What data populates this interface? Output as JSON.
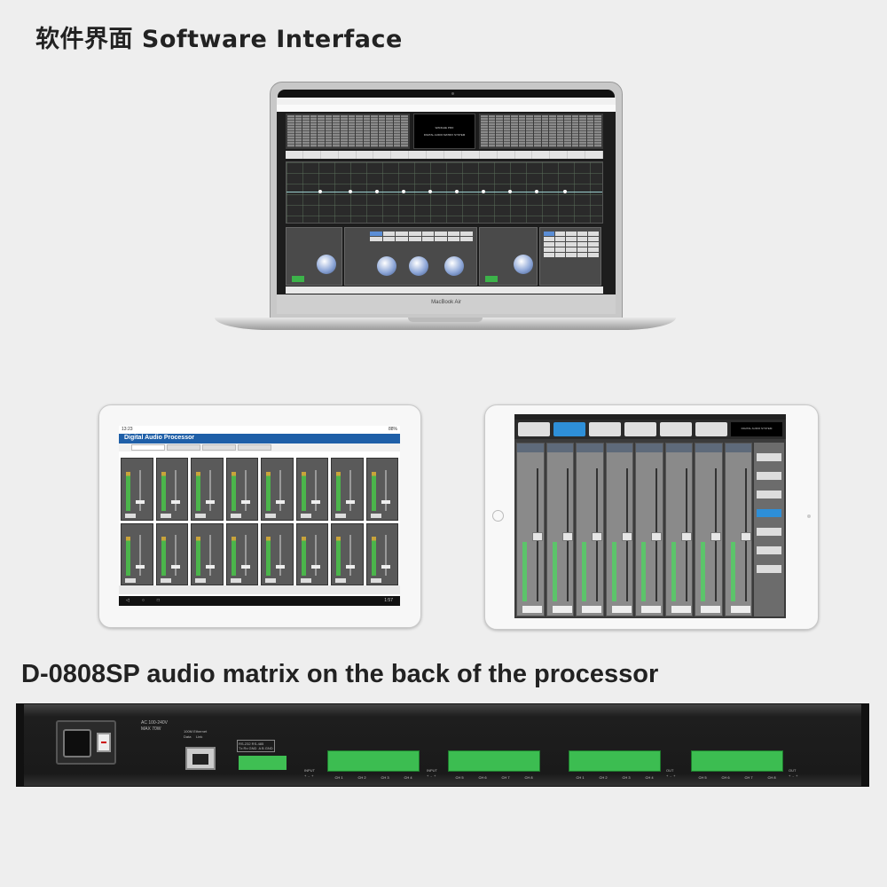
{
  "headings": {
    "software": "软件界面 Software Interface",
    "back_panel": "D-0808SP audio matrix on the back of the processor"
  },
  "laptop": {
    "brand": "MacBook Air",
    "logo_line1": "WANGHE PRO",
    "logo_line2": "DIGITAL AUDIO MATRIX SYSTEM"
  },
  "android_tablet": {
    "time": "13:23",
    "battery": "88%",
    "app_title": "Digital Audio Processor",
    "clock": "1:57"
  },
  "ipad": {
    "logo_text": "DIGITAL AUDIO SYSTEM"
  },
  "rack": {
    "ac_label": "AC 100-240V\nMAX 70W",
    "eth_label": "100M Ethernet\nData     Link",
    "rs_label": "RS-232 RS-485\nTx Rx GND  A B GND",
    "input_label": "INPUT\n+  -  +",
    "out_label": "OUT\n+  -  +",
    "groups": [
      {
        "channels": [
          "CH 1",
          "CH 2",
          "CH 3",
          "CH 4"
        ]
      },
      {
        "channels": [
          "CH 5",
          "CH 6",
          "CH 7",
          "CH 8"
        ]
      },
      {
        "channels": [
          "CH 1",
          "CH 2",
          "CH 3",
          "CH 4"
        ]
      },
      {
        "channels": [
          "CH 5",
          "CH 6",
          "CH 7",
          "CH 8"
        ]
      }
    ]
  }
}
